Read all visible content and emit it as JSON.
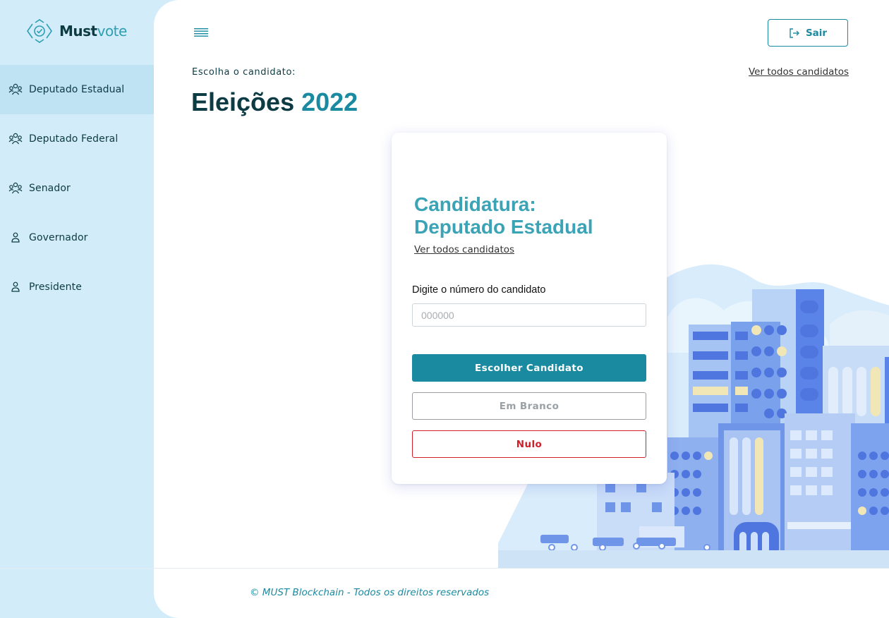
{
  "app": {
    "logo_text_dark": "Must",
    "logo_text_light": "vote",
    "brand_color": "#1a8aa1",
    "accent_color": "#3aa3b5",
    "danger_color": "#d0212b"
  },
  "sidebar": {
    "items": [
      {
        "label": "Deputado Estadual",
        "icon": "group-icon",
        "active": true
      },
      {
        "label": "Deputado Federal",
        "icon": "group-icon",
        "active": false
      },
      {
        "label": "Senador",
        "icon": "group-icon",
        "active": false
      },
      {
        "label": "Governador",
        "icon": "person-icon",
        "active": false
      },
      {
        "label": "Presidente",
        "icon": "person-icon",
        "active": false
      }
    ]
  },
  "header": {
    "menu_icon": "hamburger-icon",
    "logout_label": "Sair",
    "logout_icon": "logout-icon",
    "subtitle": "Escolha o candidato:",
    "see_all_link": "Ver todos candidatos",
    "title_main": "Eleições",
    "title_year": "2022"
  },
  "card": {
    "title_line1": "Candidatura:",
    "title_line2": "Deputado Estadual",
    "see_all_link": "Ver todos candidatos",
    "input_label": "Digite o número do candidato",
    "input_placeholder": "000000",
    "input_value": "",
    "choose_button": "Escolher Candidato",
    "blank_button": "Em Branco",
    "null_button": "Nulo"
  },
  "footer": {
    "text": "© MUST Blockchain - Todos os direitos reservados"
  }
}
